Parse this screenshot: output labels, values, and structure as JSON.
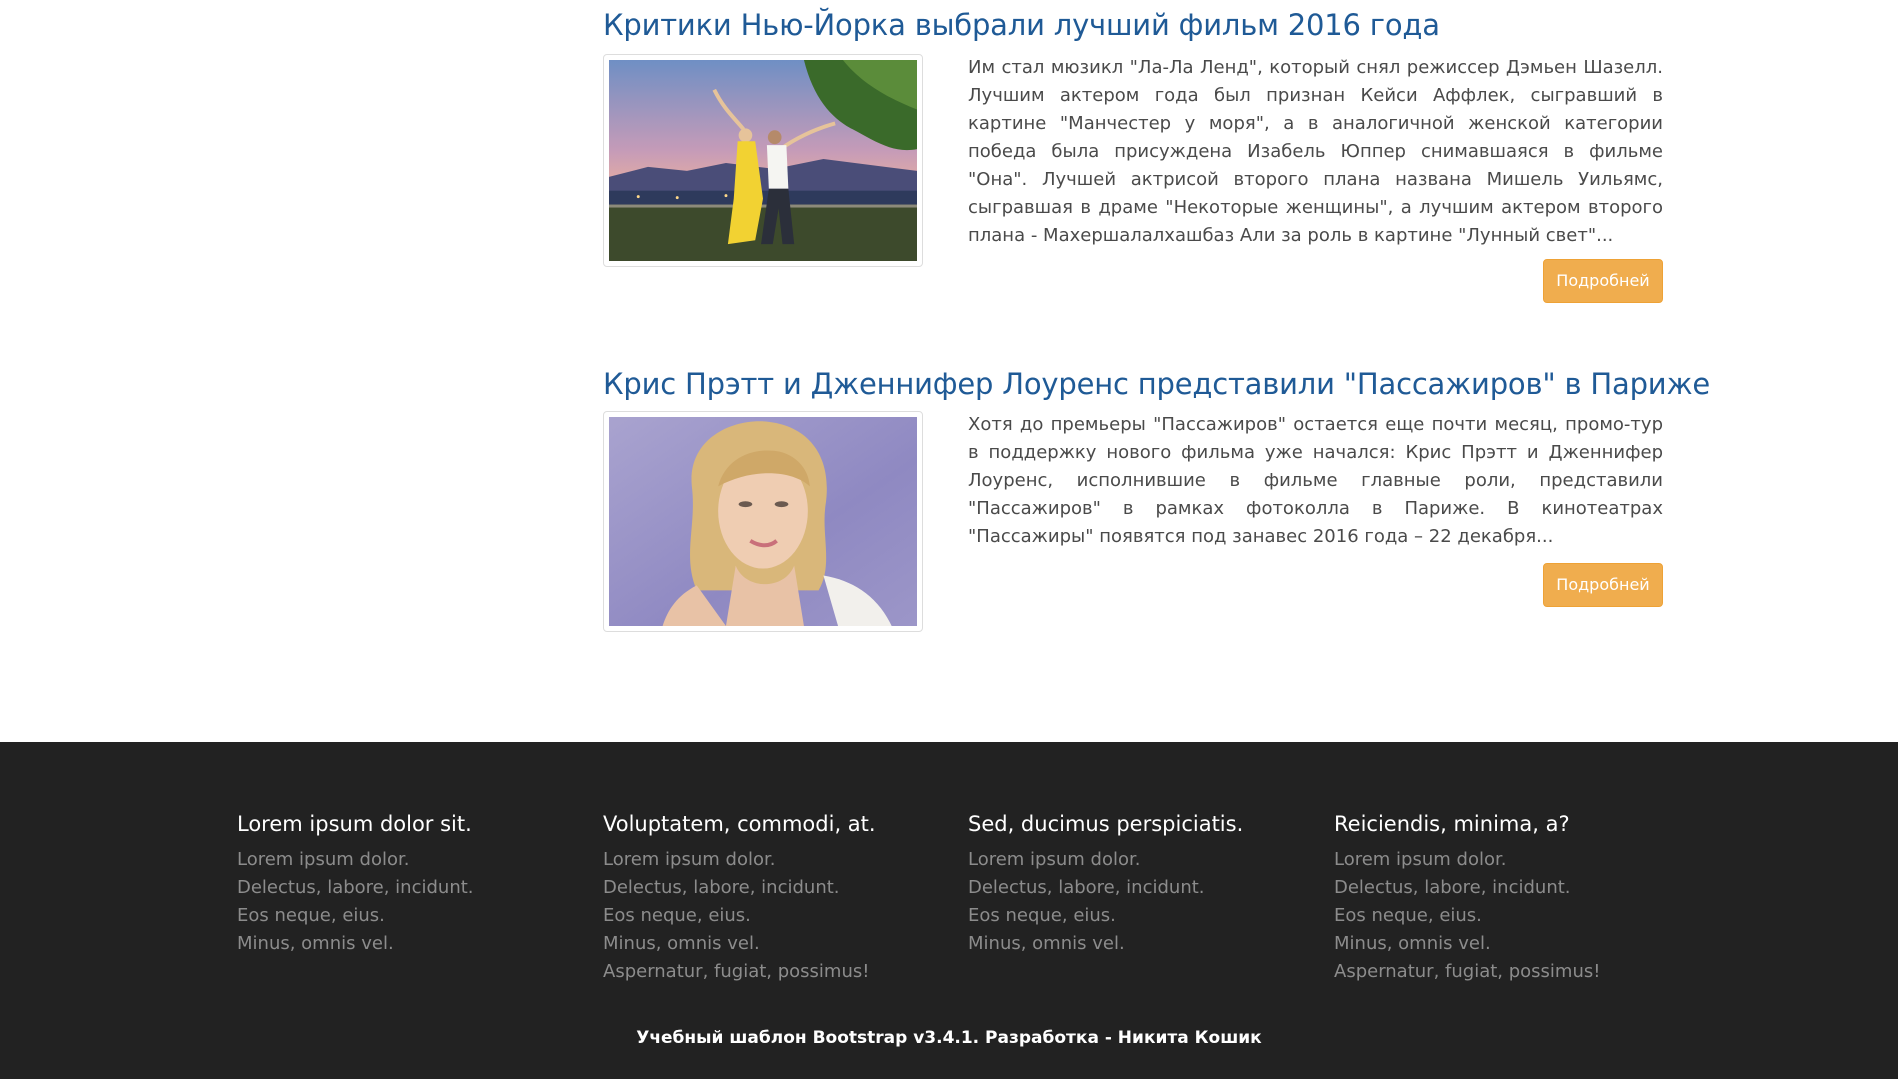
{
  "articles": [
    {
      "title": "Критики Нью-Йорка выбрали лучший фильм 2016 года",
      "text": "Им стал мюзикл \"Ла-Ла Ленд\", который снял режиссер Дэмьен Шазелл. Лучшим актером года был признан Кейси Аффлек, сыгравший в картине \"Манчестер у моря\", а в аналогичной женской категории победа была присуждена Изабель Юппер снимавшаяся в фильме \"Она\". Лучшей актрисой второго плана названа Мишель Уильямс, сыгравшая в драме \"Некоторые женщины\", а лучшим актером второго плана - Махершалалхашбаз Али за роль в картине \"Лунный свет\"...",
      "button": "Подробней"
    },
    {
      "title": "Крис Прэтт и Дженнифер Лоуренс представили \"Пассажиров\" в Париже",
      "text": "Хотя до премьеры \"Пассажиров\" остается еще почти месяц, промо-тур в поддержку нового фильма уже начался: Крис Прэтт и Дженнифер Лоуренс, исполнившие в фильме главные роли, представили \"Пассажиров\" в рамках фотоколла в Париже. В кинотеатрах \"Пассажиры\" появятся под занавес 2016 года – 22 декабря...",
      "button": "Подробней"
    }
  ],
  "footer": {
    "columns": [
      {
        "heading": "Lorem ipsum dolor sit.",
        "links": [
          "Lorem ipsum dolor.",
          "Delectus, labore, incidunt.",
          "Eos neque, eius.",
          "Minus, omnis vel."
        ]
      },
      {
        "heading": "Voluptatem, commodi, at.",
        "links": [
          "Lorem ipsum dolor.",
          "Delectus, labore, incidunt.",
          "Eos neque, eius.",
          "Minus, omnis vel.",
          "Aspernatur, fugiat, possimus!"
        ]
      },
      {
        "heading": "Sed, ducimus perspiciatis.",
        "links": [
          "Lorem ipsum dolor.",
          "Delectus, labore, incidunt.",
          "Eos neque, eius.",
          "Minus, omnis vel."
        ]
      },
      {
        "heading": "Reiciendis, minima, a?",
        "links": [
          "Lorem ipsum dolor.",
          "Delectus, labore, incidunt.",
          "Eos neque, eius.",
          "Minus, omnis vel.",
          "Aspernatur, fugiat, possimus!"
        ]
      }
    ],
    "credit": "Учебный шаблон Bootstrap v3.4.1. Разработка - Никита Кошик"
  },
  "colors": {
    "title": "#1f5a96",
    "button": "#f0ad4e",
    "footer_bg": "#222222",
    "footer_link": "#8c8c8c"
  }
}
